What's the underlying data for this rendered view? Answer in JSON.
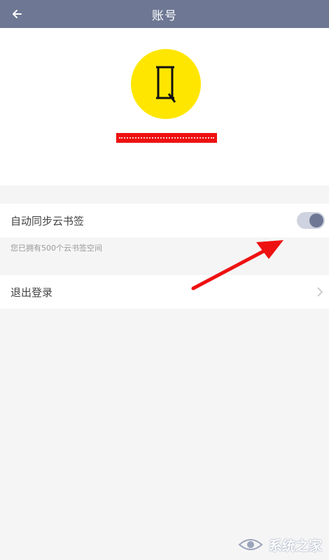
{
  "header": {
    "title": "账号",
    "back_icon": "arrow-left-icon"
  },
  "profile": {
    "avatar_letter": "Q",
    "avatar_color": "#ffe600",
    "username_redaction_color": "#ee1111"
  },
  "settings": {
    "sync_label": "自动同步云书签",
    "sync_enabled": true,
    "sync_hint": "您已拥有500个云书签空间",
    "logout_label": "退出登录"
  },
  "annotation": {
    "arrow_color": "#ee1111"
  },
  "watermark": {
    "text": "系统之家"
  },
  "colors": {
    "header_bg": "#6e7894",
    "accent": "#6e7894",
    "page_bg": "#f5f5f5"
  }
}
